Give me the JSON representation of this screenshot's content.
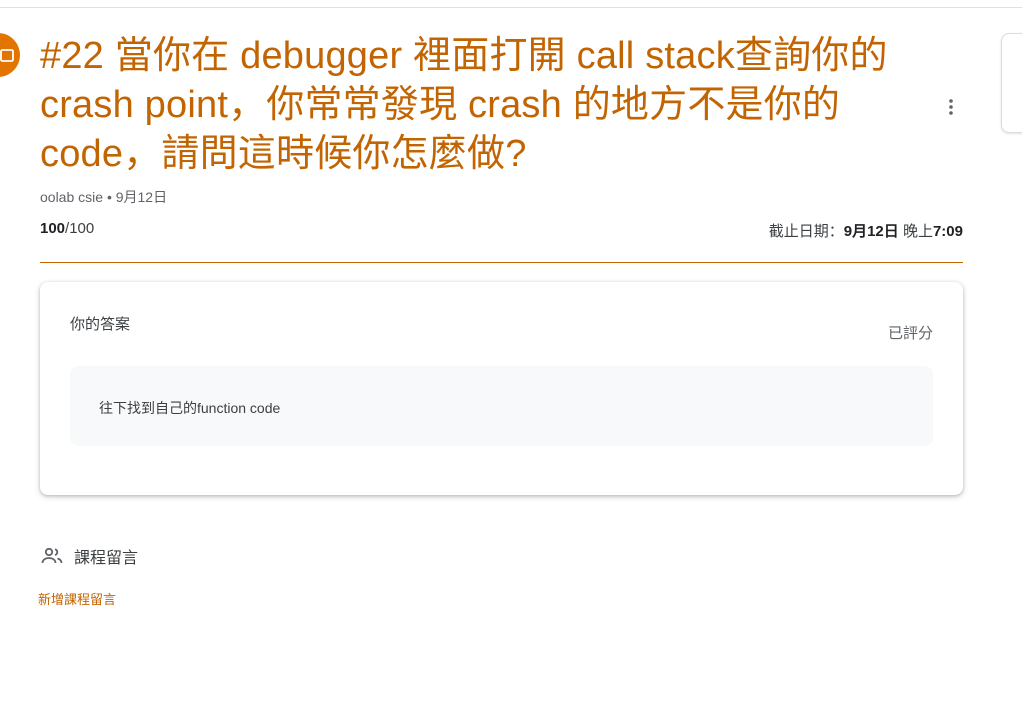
{
  "assignment": {
    "title": "#22 當你在 debugger 裡面打開 call stack查詢你的 crash point，你常常發現 crash 的地方不是你的 code，請問這時候你怎麼做?",
    "author": "oolab csie",
    "separator": "•",
    "posted_date": "9月12日",
    "score_earned": "100",
    "score_total": "/100",
    "due_label": "截止日期：",
    "due_date": "9月12日",
    "due_period": "晚上",
    "due_time": "7:09",
    "icons": {
      "assignment": "assignment-icon",
      "more": "more-vert-icon",
      "comments": "people-icon"
    }
  },
  "answer_card": {
    "heading": "你的答案",
    "status": "已評分",
    "answer_text": "往下找到自己的function code"
  },
  "comments": {
    "heading": "課程留言",
    "add_link": "新增課程留言"
  },
  "colors": {
    "accent": "#c26401",
    "icon_bg": "#e37400"
  }
}
